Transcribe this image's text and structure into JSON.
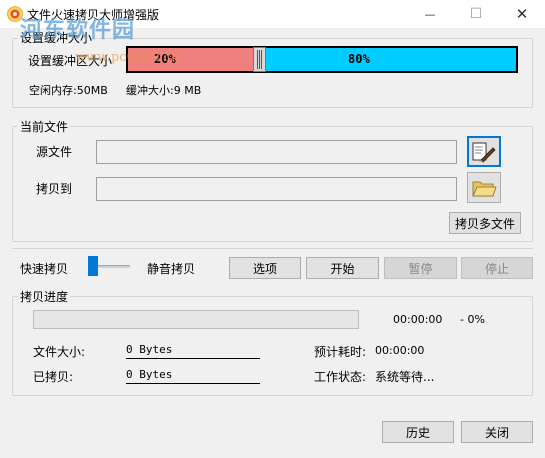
{
  "window": {
    "title": "文件火速拷贝大师增强版",
    "min_glyph": "—",
    "max_glyph": "☐",
    "close_glyph": "✕"
  },
  "watermark": {
    "text": "河东软件园",
    "url": "www.pc0359.cn"
  },
  "buffer": {
    "group_title": "设置缓冲大小",
    "inline_label": "设置缓冲区大小",
    "left_percent_label": "20%",
    "right_percent_label": "80%",
    "level": 0.2,
    "free_memory_label": "空闲内存:50MB",
    "buffer_size_label": "缓冲大小:9 MB",
    "colors": {
      "left": "#f08080",
      "right": "#00ccff"
    }
  },
  "current_file": {
    "group_title": "当前文件",
    "source_label": "源文件",
    "source_value": "",
    "dest_label": "拷贝到",
    "dest_value": "",
    "source_browse_icon": "file-browse-icon",
    "dest_browse_icon": "folder-icon",
    "multi_copy_button": "拷贝多文件"
  },
  "mode": {
    "fast_label": "快速拷贝",
    "silent_label": "静音拷贝",
    "toggle_level": 0
  },
  "actions": {
    "options": "选项",
    "start": "开始",
    "pause": "暂停",
    "stop": "停止"
  },
  "progress": {
    "group_title": "拷贝进度",
    "time_value": "00:00:00",
    "percent_value": "- 0%",
    "fraction": 0,
    "file_size_label": "文件大小:",
    "file_size_value": "0 Bytes",
    "copied_label": "已拷贝:",
    "copied_value": "0 Bytes",
    "eta_label": "预计耗时:",
    "eta_value": "00:00:00",
    "status_label": "工作状态:",
    "status_value": "系统等待..."
  },
  "footer": {
    "history": "历史",
    "close": "关闭"
  }
}
